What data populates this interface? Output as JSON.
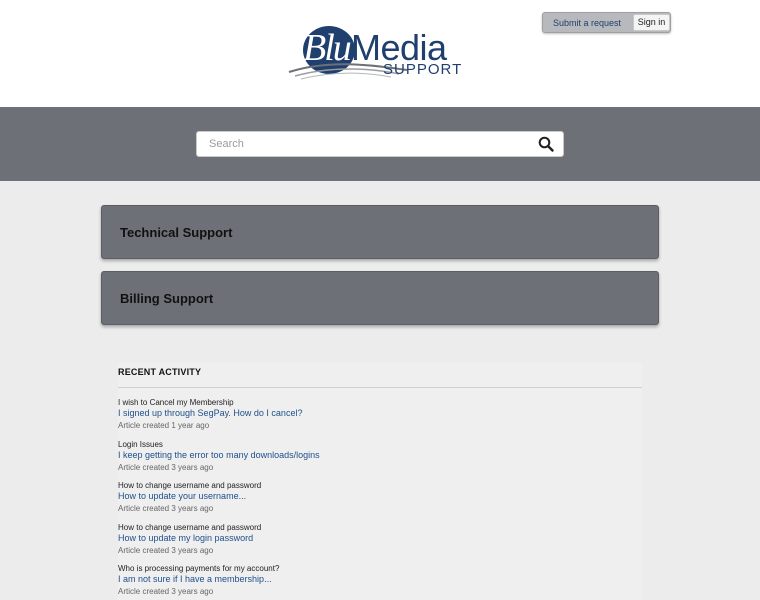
{
  "header": {
    "logo": {
      "blu": "Blu",
      "media": "Media",
      "support": "SUPPORT"
    },
    "user_nav": {
      "submit_request": "Submit a request",
      "sign_in": "Sign in"
    }
  },
  "search": {
    "placeholder": "Search",
    "icon": "search-icon"
  },
  "categories": [
    {
      "label": "Technical Support"
    },
    {
      "label": "Billing Support"
    }
  ],
  "recent_activity": {
    "title": "RECENT ACTIVITY",
    "items": [
      {
        "section": "I wish to Cancel my Membership",
        "link": "I signed up through SegPay. How do I cancel?",
        "meta": "Article created 1 year ago"
      },
      {
        "section": "Login Issues",
        "link": "I keep getting the error too many downloads/logins",
        "meta": "Article created 3 years ago"
      },
      {
        "section": "How to change username and password",
        "link": "How to update your username...",
        "meta": "Article created 3 years ago"
      },
      {
        "section": "How to change username and password",
        "link": "How to update my login password",
        "meta": "Article created 3 years ago"
      },
      {
        "section": "Who is processing payments for my account?",
        "link": "I am not sure if I have a membership...",
        "meta": "Article created 3 years ago"
      }
    ]
  },
  "colors": {
    "brand_navy": "#1f3f6e",
    "band_gray": "#6e7077",
    "link_blue": "#1f4f8a"
  }
}
